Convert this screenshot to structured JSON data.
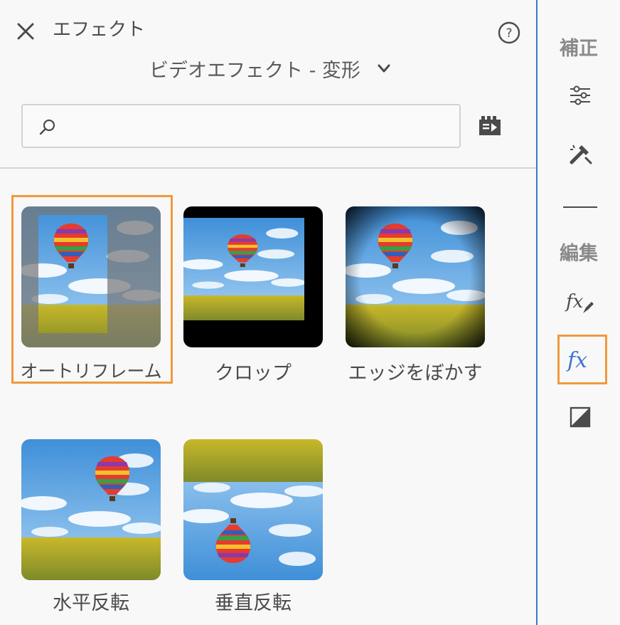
{
  "header": {
    "title": "エフェクト",
    "category_label": "ビデオエフェクト - 変形"
  },
  "search": {
    "value": "",
    "placeholder": ""
  },
  "effects": [
    {
      "label": "オートリフレーム",
      "selected": true
    },
    {
      "label": "クロップ",
      "selected": false
    },
    {
      "label": "エッジをぼかす",
      "selected": false
    },
    {
      "label": "水平反転",
      "selected": false
    },
    {
      "label": "垂直反転",
      "selected": false
    }
  ],
  "rail": {
    "correction_heading": "補正",
    "edit_heading": "編集",
    "active_item": "fx"
  },
  "colors": {
    "accent_orange": "#ef9a3c",
    "selection_blue": "#3f74d3",
    "text": "#4b4b4b"
  }
}
